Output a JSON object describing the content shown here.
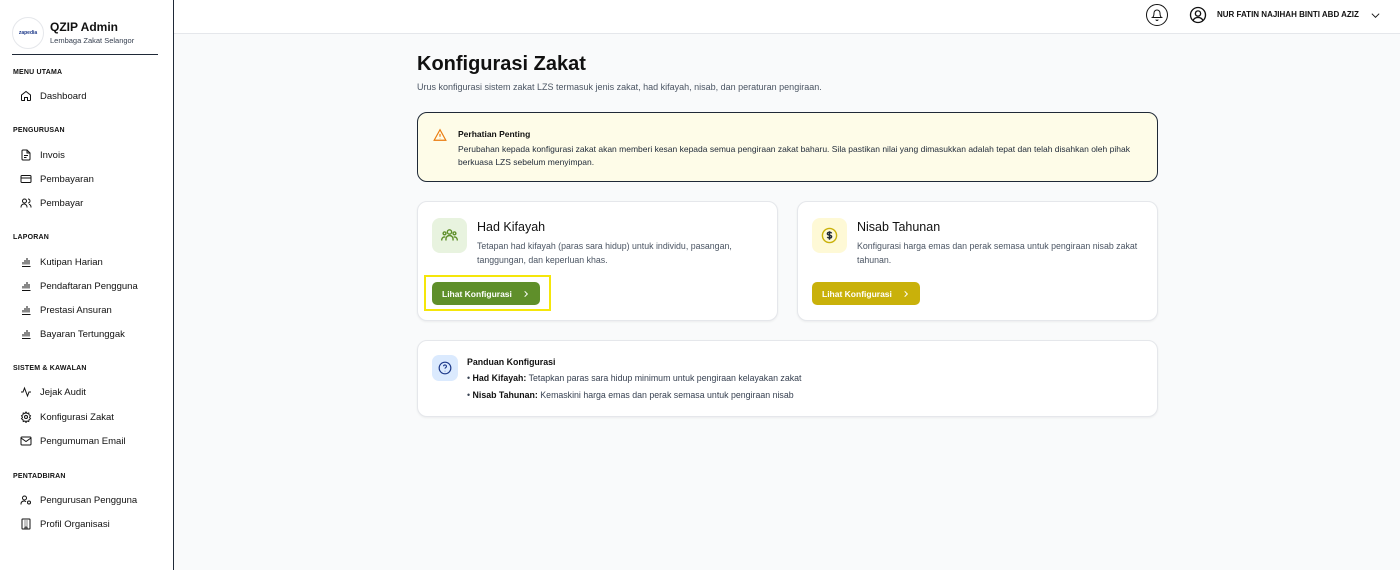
{
  "brand": {
    "logo_text": "zapedia",
    "title": "QZIP Admin",
    "subtitle": "Lembaga Zakat Selangor"
  },
  "sidebar": {
    "sections": [
      {
        "label": "MENU UTAMA",
        "items": [
          {
            "label": "Dashboard",
            "icon": "home-icon"
          }
        ]
      },
      {
        "label": "PENGURUSAN",
        "items": [
          {
            "label": "Invois",
            "icon": "file-icon"
          },
          {
            "label": "Pembayaran",
            "icon": "credit-card-icon"
          },
          {
            "label": "Pembayar",
            "icon": "users-icon"
          }
        ]
      },
      {
        "label": "LAPORAN",
        "items": [
          {
            "label": "Kutipan Harian",
            "icon": "bar-chart-icon"
          },
          {
            "label": "Pendaftaran Pengguna",
            "icon": "bar-chart-icon"
          },
          {
            "label": "Prestasi Ansuran",
            "icon": "bar-chart-icon"
          },
          {
            "label": "Bayaran Tertunggak",
            "icon": "bar-chart-icon"
          }
        ]
      },
      {
        "label": "SISTEM & KAWALAN",
        "items": [
          {
            "label": "Jejak Audit",
            "icon": "activity-icon"
          },
          {
            "label": "Konfigurasi Zakat",
            "icon": "gear-icon"
          },
          {
            "label": "Pengumuman Email",
            "icon": "mail-icon"
          }
        ]
      },
      {
        "label": "PENTADBIRAN",
        "items": [
          {
            "label": "Pengurusan Pengguna",
            "icon": "user-cog-icon"
          },
          {
            "label": "Profil Organisasi",
            "icon": "building-icon"
          }
        ]
      }
    ]
  },
  "header": {
    "user_name": "NUR FATIN NAJIHAH BINTI ABD AZIZ"
  },
  "main": {
    "title": "Konfigurasi Zakat",
    "description": "Urus konfigurasi sistem zakat LZS termasuk jenis zakat, had kifayah, nisab, dan peraturan pengiraan.",
    "alert": {
      "title": "Perhatian Penting",
      "text": "Perubahan kepada konfigurasi zakat akan memberi kesan kepada semua pengiraan zakat baharu. Sila pastikan nilai yang dimasukkan adalah tepat dan telah disahkan oleh pihak berkuasa LZS sebelum menyimpan."
    },
    "cards": [
      {
        "title": "Had Kifayah",
        "description": "Tetapan had kifayah (paras sara hidup) untuk individu, pasangan, tanggungan, dan keperluan khas.",
        "button": "Lihat Konfigurasi",
        "button_color": "#5f8f2a",
        "icon_bg": "#e8f3df"
      },
      {
        "title": "Nisab Tahunan",
        "description": "Konfigurasi harga emas dan perak semasa untuk pengiraan nisab zakat tahunan.",
        "button": "Lihat Konfigurasi",
        "button_color": "#c9b10a",
        "icon_bg": "#fef9d6"
      }
    ],
    "guide": {
      "title": "Panduan Konfigurasi",
      "lines": [
        {
          "bullet": "• ",
          "term": "Had Kifayah:",
          "text": " Tetapkan paras sara hidup minimum untuk pengiraan kelayakan zakat"
        },
        {
          "bullet": "• ",
          "term": "Nisab Tahunan:",
          "text": " Kemaskini harga emas dan perak semasa untuk pengiraan nisab"
        }
      ]
    }
  },
  "colors": {
    "highlight": "#f5e60a",
    "sidebar_border": "#1f2937",
    "alert_bg": "#fefce8"
  }
}
